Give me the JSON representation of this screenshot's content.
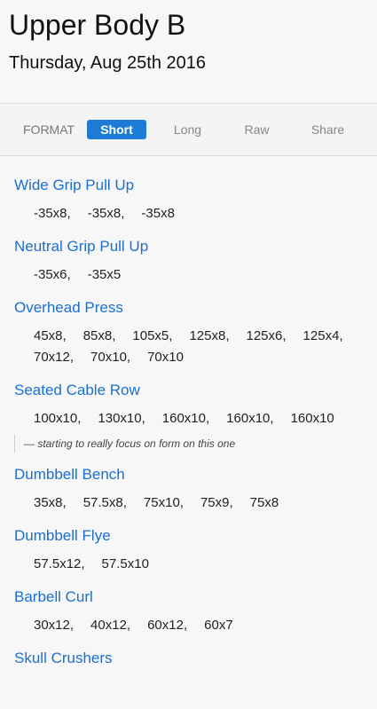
{
  "workout": {
    "title": "Upper Body B",
    "date": "Thursday, Aug 25th 2016"
  },
  "format": {
    "label": "FORMAT",
    "options": [
      "Short",
      "Long",
      "Raw",
      "Share"
    ],
    "selected": "Short"
  },
  "exercises": [
    {
      "name": "Wide Grip Pull Up",
      "sets": [
        "-35x8,",
        "-35x8,",
        "-35x8"
      ]
    },
    {
      "name": "Neutral Grip Pull Up",
      "sets": [
        "-35x6,",
        "-35x5"
      ]
    },
    {
      "name": "Overhead Press",
      "sets": [
        "45x8,",
        "85x8,",
        "105x5,",
        "125x8,",
        "125x6,",
        "125x4,",
        "70x12,",
        "70x10,",
        "70x10"
      ]
    },
    {
      "name": "Seated Cable Row",
      "sets": [
        "100x10,",
        "130x10,",
        "160x10,",
        "160x10,",
        "160x10"
      ],
      "note": "— starting to really focus on form on this one"
    },
    {
      "name": "Dumbbell Bench",
      "sets": [
        "35x8,",
        "57.5x8,",
        "75x10,",
        "75x9,",
        "75x8"
      ]
    },
    {
      "name": "Dumbbell Flye",
      "sets": [
        "57.5x12,",
        "57.5x10"
      ]
    },
    {
      "name": "Barbell Curl",
      "sets": [
        "30x12,",
        "40x12,",
        "60x12,",
        "60x7"
      ]
    },
    {
      "name": "Skull Crushers",
      "sets": []
    }
  ]
}
